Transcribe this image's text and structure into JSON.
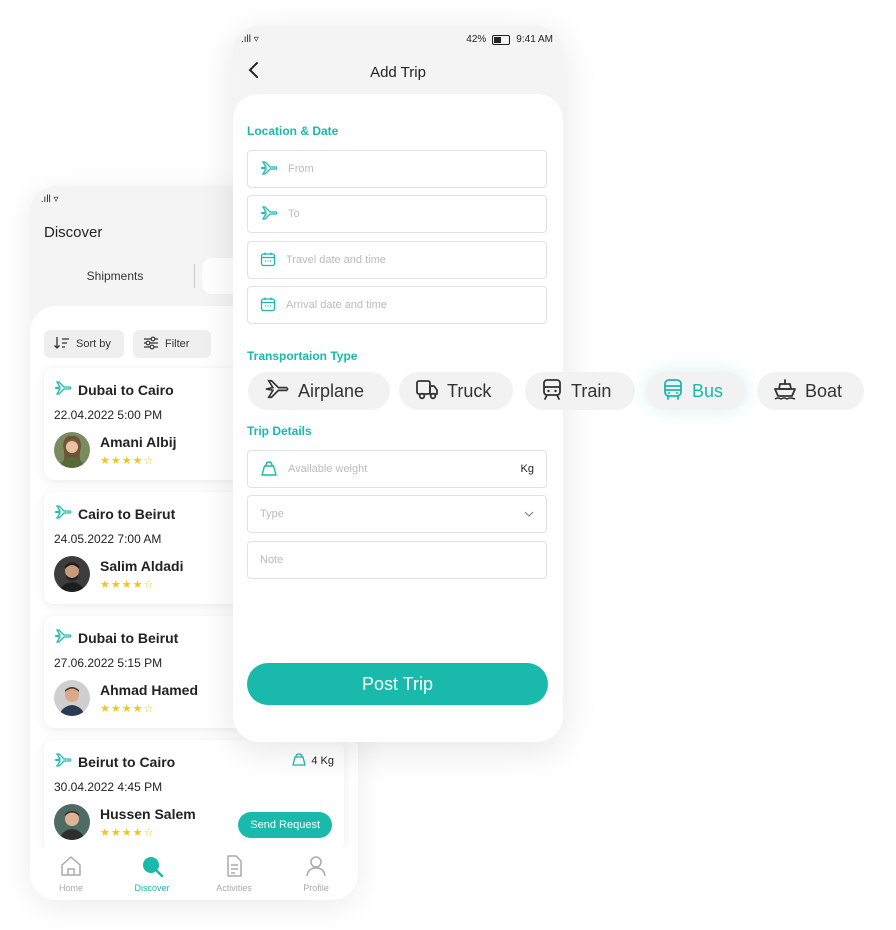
{
  "back_phone": {
    "status": " .ıll ▿",
    "title": "Discover",
    "segments": [
      "Shipments",
      ""
    ],
    "toolbar": {
      "sort_label": "Sort by",
      "filter_label": "Filter"
    },
    "cards": [
      {
        "route": "Dubai to Cairo",
        "date": "22.04.2022  5:00 PM",
        "name": "Amani Albij",
        "stars": "★★★★☆"
      },
      {
        "route": "Cairo to Beirut",
        "date": "24.05.2022  7:00 AM",
        "name": "Salim Aldadi",
        "stars": "★★★★☆"
      },
      {
        "route": "Dubai to Beirut",
        "date": "27.06.2022  5:15 PM",
        "name": "Ahmad Hamed",
        "stars": "★★★★☆"
      },
      {
        "route": "Beirut to Cairo",
        "date": "30.04.2022  4:45 PM",
        "name": "Hussen Salem",
        "stars": "★★★★☆",
        "weight": "4 Kg",
        "action": "Send Request"
      }
    ],
    "tabs": [
      {
        "label": "Home",
        "icon": "home-icon"
      },
      {
        "label": "Discover",
        "icon": "search-icon"
      },
      {
        "label": "Activities",
        "icon": "document-icon"
      },
      {
        "label": "Profile",
        "icon": "user-icon"
      }
    ],
    "accent": "#19b9ac"
  },
  "front_phone": {
    "status_left": ".ıll ▿",
    "battery": "42%",
    "time": "9:41 AM",
    "title": "Add Trip",
    "sections": {
      "location": "Location & Date",
      "transport": "Transportaion Type",
      "details": "Trip Details"
    },
    "fields": {
      "from": "From",
      "to": "To",
      "travel_date": "Travel date and time",
      "arrival_date": "Arrival date and time",
      "weight": "Available weight",
      "weight_unit": "Kg",
      "type": "Type",
      "note": "Note"
    },
    "post_label": "Post Trip"
  },
  "transport_options": [
    {
      "label": "Airplane",
      "icon": "airplane-icon"
    },
    {
      "label": "Truck",
      "icon": "truck-icon"
    },
    {
      "label": "Train",
      "icon": "train-icon"
    },
    {
      "label": "Bus",
      "icon": "bus-icon",
      "selected": true
    },
    {
      "label": "Boat",
      "icon": "boat-icon"
    }
  ]
}
